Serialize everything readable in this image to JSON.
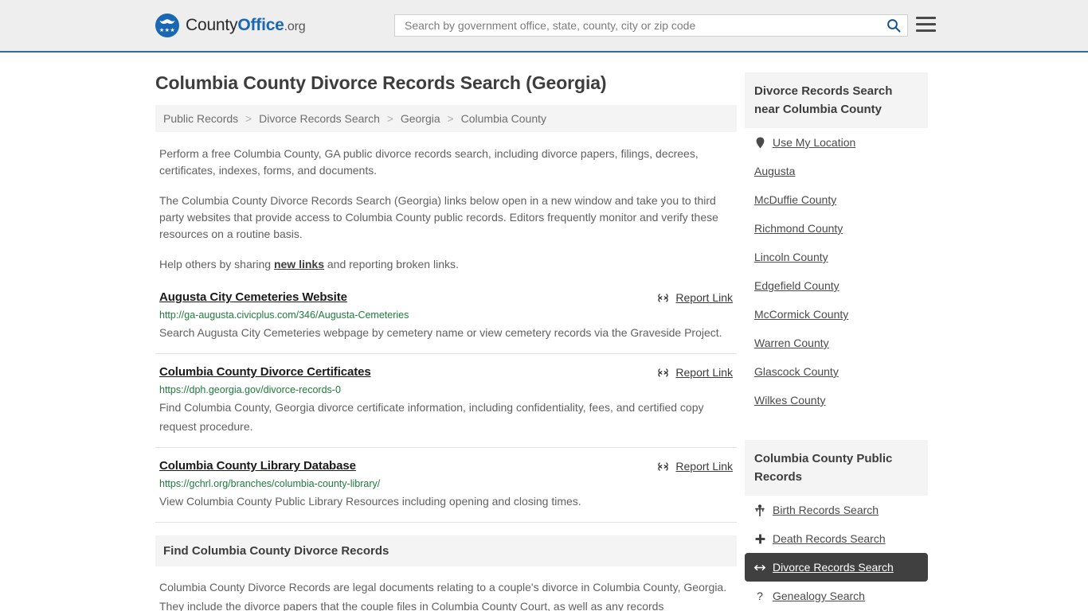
{
  "header": {
    "logo": {
      "part1": "County",
      "part2": "Office",
      "part3": ".org",
      "icon": "eagle-shield-logo"
    },
    "search": {
      "placeholder": "Search by government office, state, county, city or zip code",
      "value": "",
      "icon": "search-icon"
    },
    "menu_icon": "hamburger-menu-icon",
    "accent_color": "#2b6ca3",
    "background_color": "#eeeeee"
  },
  "main": {
    "title": "Columbia County Divorce Records Search (Georgia)",
    "breadcrumb": [
      "Public Records",
      "Divorce Records Search",
      "Georgia",
      "Columbia County"
    ],
    "breadcrumb_separator": ">",
    "paragraphs": [
      "Perform a free Columbia County, GA public divorce records search, including divorce papers, filings, decrees, certificates, indexes, forms, and documents.",
      "The Columbia County Divorce Records Search (Georgia) links below open in a new window and take you to third party websites that provide access to Columbia County public records. Editors frequently monitor and verify these resources on a routine basis."
    ],
    "help_prefix": "Help others by sharing ",
    "help_link": "new links",
    "help_suffix": " and reporting broken links.",
    "report_link_label": "Report Link",
    "report_link_icon": "broken-link-icon",
    "results": [
      {
        "title": "Augusta City Cemeteries Website",
        "url": "http://ga-augusta.civicplus.com/346/Augusta-Cemeteries",
        "description": "Search Augusta City Cemeteries webpage by cemetery name or view cemetery records via the Graveside Project."
      },
      {
        "title": "Columbia County Divorce Certificates",
        "url": "https://dph.georgia.gov/divorce-records-0",
        "description": "Find Columbia County, Georgia divorce certificate information, including confidentiality, fees, and certified copy request procedure."
      },
      {
        "title": "Columbia County Library Database",
        "url": "https://gchrl.org/branches/columbia-county-library/",
        "description": "View Columbia County Public Library Resources including opening and closing times."
      }
    ],
    "bottom_section": {
      "heading": "Find Columbia County Divorce Records",
      "body": "Columbia County Divorce Records are legal documents relating to a couple's divorce in Columbia County, Georgia. They include the divorce papers that the couple files in Columbia County Court, as well as any records"
    }
  },
  "sidebar": {
    "nearby": {
      "heading": "Divorce Records Search near Columbia County",
      "use_my_location": {
        "label": "Use My Location",
        "icon": "map-pin-icon"
      },
      "places": [
        "Augusta",
        "McDuffie County",
        "Richmond County",
        "Lincoln County",
        "Edgefield County",
        "McCormick County",
        "Warren County",
        "Glascock County",
        "Wilkes County"
      ]
    },
    "public_records": {
      "heading": "Columbia County Public Records",
      "items": [
        {
          "label": "Birth Records Search",
          "icon": "baby-icon",
          "active": false
        },
        {
          "label": "Death Records Search",
          "icon": "cross-icon",
          "active": false
        },
        {
          "label": "Divorce Records Search",
          "icon": "arrows-left-right-icon",
          "active": true
        },
        {
          "label": "Genealogy Search",
          "icon": "question-mark-icon",
          "active": false
        }
      ],
      "active_background": "#404040"
    }
  }
}
